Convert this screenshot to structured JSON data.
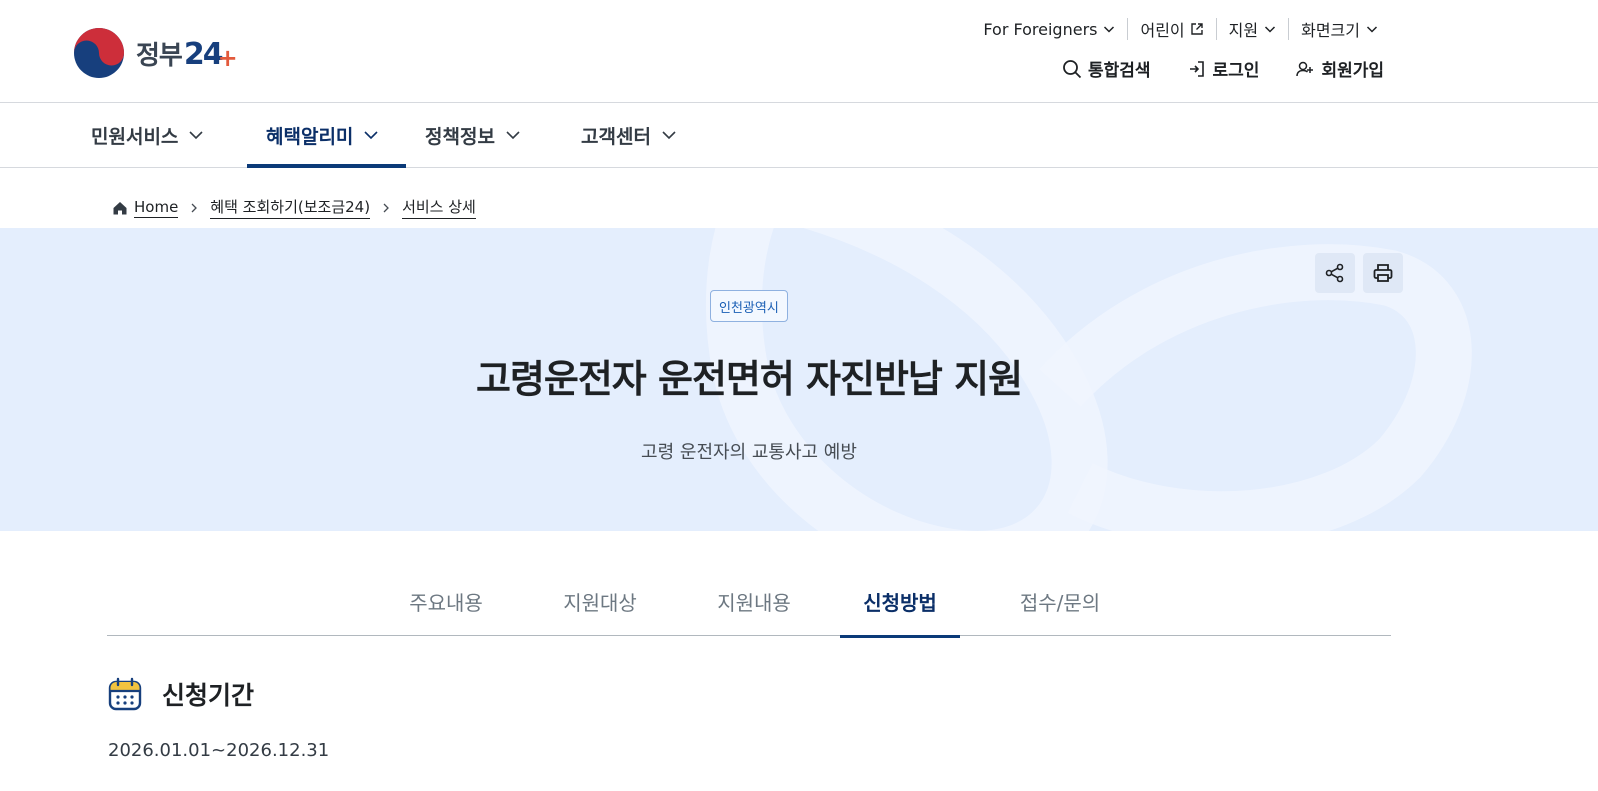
{
  "logo": {
    "word": "정부",
    "num": "24",
    "plus": "+"
  },
  "util_menu": [
    {
      "label": "For Foreigners",
      "icon": "chevron-down-icon"
    },
    {
      "label": "어린이",
      "icon": "external-link-icon"
    },
    {
      "label": "지원",
      "icon": "chevron-down-icon"
    },
    {
      "label": "화면크기",
      "icon": "chevron-down-icon"
    }
  ],
  "auth_menu": [
    {
      "label": "통합검색",
      "icon": "search-icon"
    },
    {
      "label": "로그인",
      "icon": "login-icon"
    },
    {
      "label": "회원가입",
      "icon": "user-add-icon"
    }
  ],
  "gnb": [
    {
      "label": "민원서비스"
    },
    {
      "label": "혜택알리미",
      "active": true
    },
    {
      "label": "정책정보"
    },
    {
      "label": "고객센터"
    }
  ],
  "breadcrumb": [
    {
      "label": "Home"
    },
    {
      "label": "혜택 조회하기(보조금24)"
    },
    {
      "label": "서비스 상세"
    }
  ],
  "hero": {
    "region": "인천광역시",
    "title": "고령운전자 운전면허 자진반납 지원",
    "subtitle": "고령 운전자의 교통사고 예방",
    "share_icon": "share-icon",
    "print_icon": "print-icon"
  },
  "tabs": [
    {
      "label": "주요내용"
    },
    {
      "label": "지원대상"
    },
    {
      "label": "지원내용"
    },
    {
      "label": "신청방법",
      "active": true
    },
    {
      "label": "접수/문의"
    }
  ],
  "section": {
    "icon": "calendar-icon",
    "title": "신청기간",
    "body": "2026.01.01~2026.12.31"
  },
  "colors": {
    "accent": "#0b3a78",
    "hero_bg": "#e4eefd",
    "badge_text": "#1b5fb5"
  }
}
